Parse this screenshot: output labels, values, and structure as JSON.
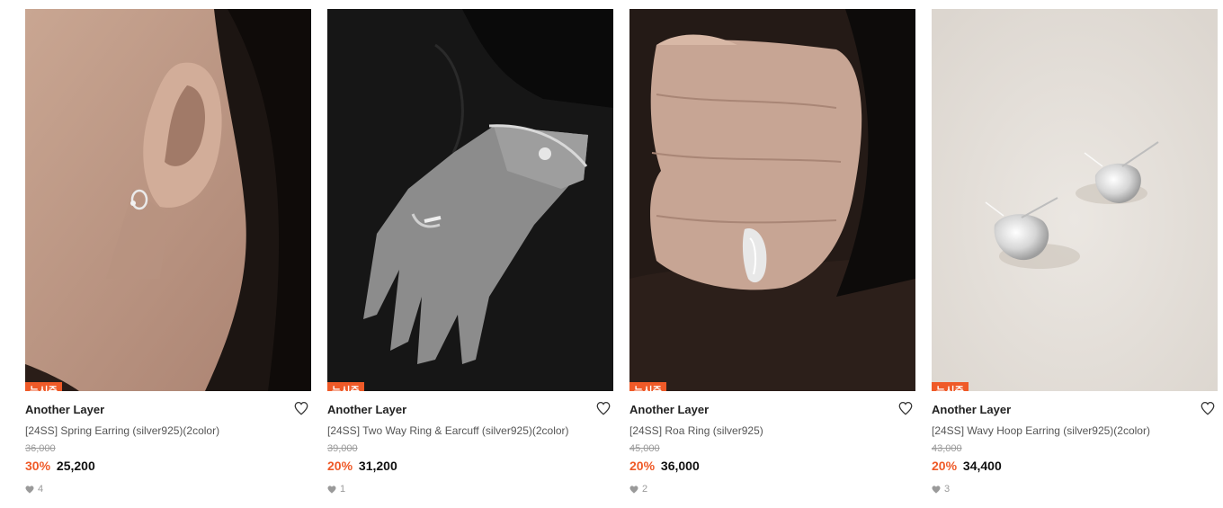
{
  "products": [
    {
      "badge": "뉴시즌",
      "brand": "Another Layer",
      "name": "[24SS] Spring Earring (silver925)(2color)",
      "original_price": "36,000",
      "discount": "30%",
      "price": "25,200",
      "likes": "4",
      "image": "earring-on-ear"
    },
    {
      "badge": "뉴시즌",
      "brand": "Another Layer",
      "name": "[24SS] Two Way Ring & Earcuff (silver925)(2color)",
      "original_price": "39,000",
      "discount": "20%",
      "price": "31,200",
      "likes": "1",
      "image": "hand-with-ring-and-bracelet"
    },
    {
      "badge": "뉴시즌",
      "brand": "Another Layer",
      "name": "[24SS] Roa Ring (silver925)",
      "original_price": "45,000",
      "discount": "20%",
      "price": "36,000",
      "likes": "2",
      "image": "hand-with-ring-in-hair"
    },
    {
      "badge": "뉴시즌",
      "brand": "Another Layer",
      "name": "[24SS] Wavy Hoop Earring (silver925)(2color)",
      "original_price": "43,000",
      "discount": "20%",
      "price": "34,400",
      "likes": "3",
      "image": "silver-hoop-earrings"
    }
  ],
  "colors": {
    "badge_bg": "#ef5a28",
    "discount": "#ef5a28",
    "muted": "#9a9a9a"
  },
  "icons": {
    "wishlist": "heart-outline-icon",
    "likes": "heart-filled-icon"
  }
}
